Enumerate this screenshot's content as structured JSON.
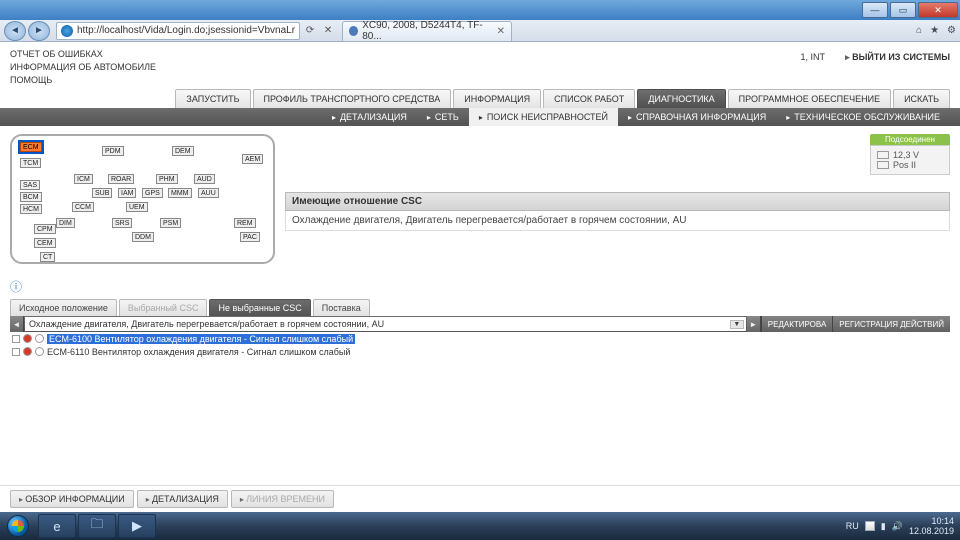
{
  "window": {
    "url": "http://localhost/Vida/Login.do;jsessionid=VbvnaLr",
    "tab_title": "XC90, 2008, D5244T4, TF-80..."
  },
  "header": {
    "links": {
      "errors": "ОТЧЕТ ОБ ОШИБКАХ",
      "carinfo": "ИНФОРМАЦИЯ ОБ АВТОМОБИЛЕ",
      "help": "ПОМОЩЬ"
    },
    "user": "1, INT",
    "logout": "ВЫЙТИ ИЗ СИСТЕМЫ"
  },
  "main_tabs": {
    "start": "ЗАПУСТИТЬ",
    "profile": "ПРОФИЛЬ ТРАНСПОРТНОГО СРЕДСТВА",
    "info": "ИНФОРМАЦИЯ",
    "jobs": "СПИСОК РАБОТ",
    "diag": "ДИАГНОСТИКА",
    "sw": "ПРОГРАММНОЕ ОБЕСПЕЧЕНИЕ",
    "search": "ИСКАТЬ"
  },
  "sub_tabs": {
    "detail": "ДЕТАЛИЗАЦИЯ",
    "net": "СЕТЬ",
    "fault": "ПОИСК НЕИСПРАВНОСТЕЙ",
    "ref": "СПРАВОЧНАЯ ИНФОРМАЦИЯ",
    "maint": "ТЕХНИЧЕСКОЕ ОБСЛУЖИВАНИЕ"
  },
  "diagram_modules": {
    "ecm": "ECM",
    "tcm": "TCM",
    "pdm": "PDM",
    "dem": "DEM",
    "aem": "AEM",
    "sas": "SAS",
    "bcm": "BCM",
    "hcm": "HCM",
    "icm": "ICM",
    "roar": "ROAR",
    "phm": "PHM",
    "aud": "AUD",
    "sub": "SUB",
    "iam": "IAM",
    "gps": "GPS",
    "mmm": "MMM",
    "auu": "AUU",
    "ccm": "CCM",
    "uem": "UEM",
    "dim": "DIM",
    "srs": "SRS",
    "psm": "PSM",
    "ddm": "DDM",
    "cpm": "CPM",
    "rem": "REM",
    "pac": "PAC",
    "cem": "CEM",
    "ct": "CT"
  },
  "status": {
    "head": "Подсоединен",
    "voltage": "12,3 V",
    "key": "Pos II"
  },
  "csc": {
    "head": "Имеющие отношение CSC",
    "body": "Охлаждение двигателя, Двигатель перегревается/работает в горячем состоянии, AU"
  },
  "lower_tabs": {
    "home": "Исходное положение",
    "selected": "Выбранный CSC",
    "unselected": "Не выбранные CSC",
    "supply": "Поставка"
  },
  "tool_row": {
    "select_text": "Охлаждение двигателя, Двигатель перегревается/работает в горячем состоянии, AU",
    "edit": "РЕДАКТИРОВА",
    "reg": "РЕГИСТРАЦИЯ ДЕЙСТВИЙ"
  },
  "dtcs": [
    {
      "code": "ECM-6100 Вентилятор охлаждения двигателя - Сигнал слишком слабый",
      "selected": true
    },
    {
      "code": "ECM-6110 Вентилятор охлаждения двигателя - Сигнал слишком слабый",
      "selected": false
    }
  ],
  "footer_tabs": {
    "overview": "ОБЗОР ИНФОРМАЦИИ",
    "detail": "ДЕТАЛИЗАЦИЯ",
    "timeline": "ЛИНИЯ ВРЕМЕНИ"
  },
  "taskbar": {
    "lang": "RU",
    "time": "10:14",
    "date": "12.08.2019"
  }
}
